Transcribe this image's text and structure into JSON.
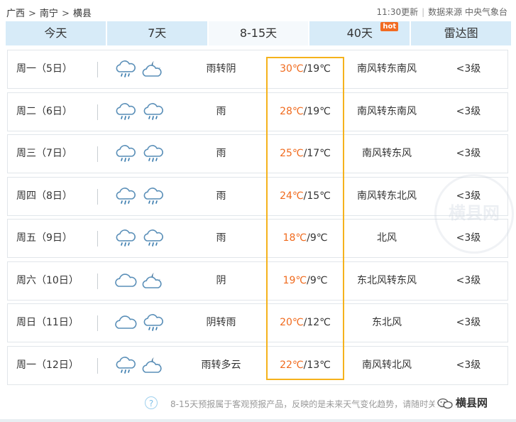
{
  "breadcrumb": [
    "广西",
    "南宁",
    "横县"
  ],
  "breadcrumb_separator": ">",
  "update_time": "11:30更新",
  "data_source": "数据来源 中央气象台",
  "tabs": [
    {
      "label": "今天",
      "active": false
    },
    {
      "label": "7天",
      "active": false
    },
    {
      "label": "8-15天",
      "active": true
    },
    {
      "label": "40天",
      "active": false,
      "badge": "hot"
    },
    {
      "label": "雷达图",
      "active": false
    }
  ],
  "days": [
    {
      "day": "周一（5日）",
      "icons": [
        "rain-cloud-icon",
        "partly-cloudy-moon-icon"
      ],
      "weather": "雨转阴",
      "high": "30℃",
      "low": "19℃",
      "wind": "南风转东南风",
      "level": "<3级"
    },
    {
      "day": "周二（6日）",
      "icons": [
        "rain-cloud-icon",
        "rain-cloud-icon"
      ],
      "weather": "雨",
      "high": "28℃",
      "low": "19℃",
      "wind": "南风转东南风",
      "level": "<3级"
    },
    {
      "day": "周三（7日）",
      "icons": [
        "rain-cloud-icon",
        "rain-cloud-icon"
      ],
      "weather": "雨",
      "high": "25℃",
      "low": "17℃",
      "wind": "南风转东风",
      "level": "<3级"
    },
    {
      "day": "周四（8日）",
      "icons": [
        "rain-cloud-icon",
        "rain-cloud-icon"
      ],
      "weather": "雨",
      "high": "24℃",
      "low": "15℃",
      "wind": "南风转东北风",
      "level": "<3级"
    },
    {
      "day": "周五（9日）",
      "icons": [
        "rain-cloud-icon",
        "rain-cloud-icon"
      ],
      "weather": "雨",
      "high": "18℃",
      "low": "9℃",
      "wind": "北风",
      "level": "<3级"
    },
    {
      "day": "周六（10日）",
      "icons": [
        "cloud-icon",
        "partly-cloudy-moon-icon"
      ],
      "weather": "阴",
      "high": "19℃",
      "low": "9℃",
      "wind": "东北风转东风",
      "level": "<3级"
    },
    {
      "day": "周日（11日）",
      "icons": [
        "cloud-icon",
        "rain-cloud-icon"
      ],
      "weather": "阴转雨",
      "high": "20℃",
      "low": "12℃",
      "wind": "东北风",
      "level": "<3级"
    },
    {
      "day": "周一（12日）",
      "icons": [
        "rain-cloud-icon",
        "partly-cloudy-moon-icon"
      ],
      "weather": "雨转多云",
      "high": "22℃",
      "low": "13℃",
      "wind": "南风转北风",
      "level": "<3级"
    }
  ],
  "temp_separator": "/",
  "footnote": "8-15天预报属于客观预报产品，反映的是未来天气变化趋势，请随时关注最新预报。",
  "watermark": "横县网",
  "brand": "横县网",
  "colors": {
    "tab_bg": "#d7ebf8",
    "tab_active_bg": "#f5f9fc",
    "high_temp": "#f06a1d",
    "highlight_border": "#f5b21c",
    "hot_badge": "#f26b22"
  }
}
